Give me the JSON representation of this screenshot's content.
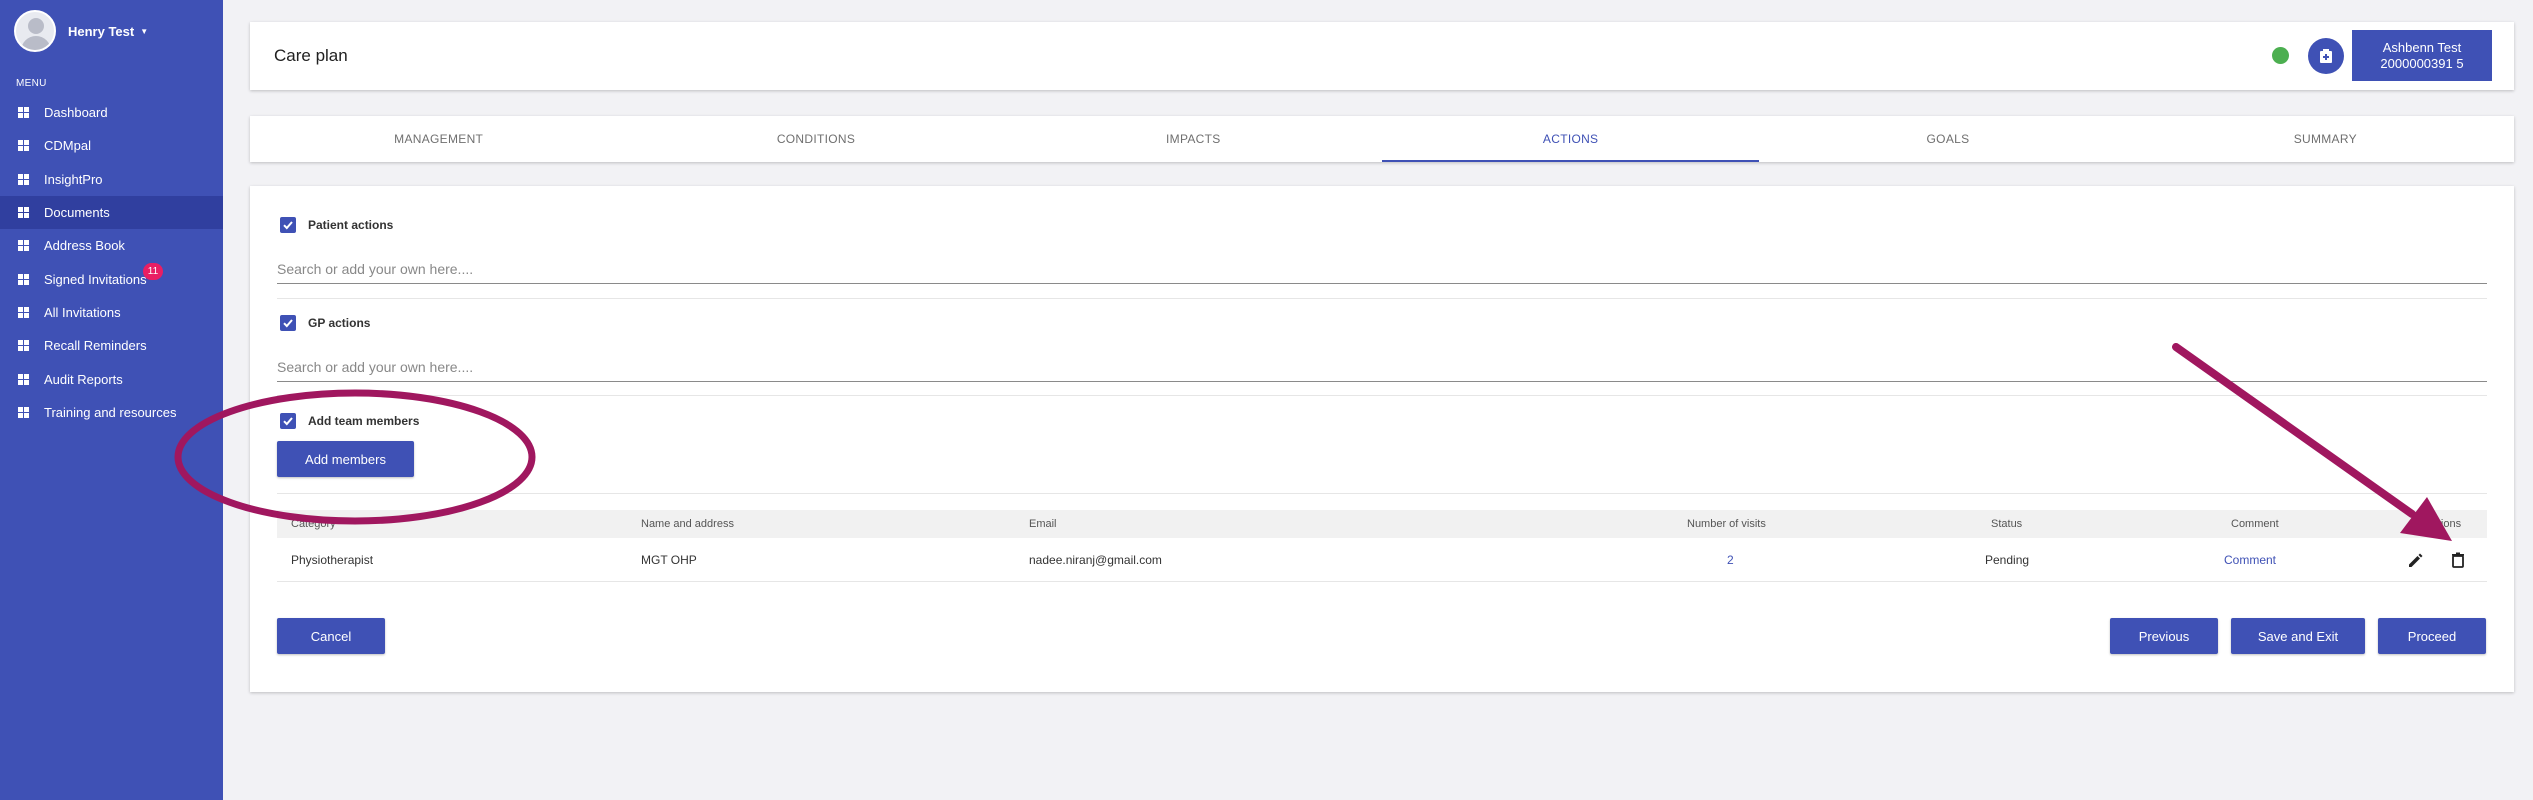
{
  "user": {
    "name": "Henry Test"
  },
  "sidebar": {
    "menu_title": "MENU",
    "items": [
      {
        "label": "Dashboard"
      },
      {
        "label": "CDMpal"
      },
      {
        "label": "InsightPro"
      },
      {
        "label": "Documents",
        "active": true
      },
      {
        "label": "Address Book"
      },
      {
        "label": "Signed Invitations",
        "badge": "11"
      },
      {
        "label": "All Invitations"
      },
      {
        "label": "Recall Reminders"
      },
      {
        "label": "Audit Reports"
      },
      {
        "label": "Training and resources"
      }
    ]
  },
  "header": {
    "title": "Care plan",
    "patient_name": "Ashbenn Test",
    "patient_id": "2000000391 5"
  },
  "tabs": [
    {
      "label": "MANAGEMENT"
    },
    {
      "label": "CONDITIONS"
    },
    {
      "label": "IMPACTS"
    },
    {
      "label": "ACTIONS",
      "active": true
    },
    {
      "label": "GOALS"
    },
    {
      "label": "SUMMARY"
    }
  ],
  "actions": {
    "patient_actions_label": "Patient actions",
    "patient_search_placeholder": "Search or add your own here....",
    "gp_actions_label": "GP actions",
    "gp_search_placeholder": "Search or add your own here....",
    "team_members_label": "Add team members",
    "add_members_button": "Add members"
  },
  "table": {
    "headers": [
      "Category",
      "Name and address",
      "Email",
      "Number of visits",
      "Status",
      "Comment",
      "Actions"
    ],
    "rows": [
      {
        "category": "Physiotherapist",
        "name_address": "MGT OHP",
        "email": "nadee.niranj@gmail.com",
        "visits": "2",
        "status": "Pending",
        "comment": "Comment"
      }
    ]
  },
  "footer": {
    "cancel": "Cancel",
    "previous": "Previous",
    "save_exit": "Save and Exit",
    "proceed": "Proceed"
  },
  "colors": {
    "primary": "#3f51b5",
    "annotation": "#a0175f",
    "online": "#4caf50",
    "badge": "#e91e63"
  }
}
